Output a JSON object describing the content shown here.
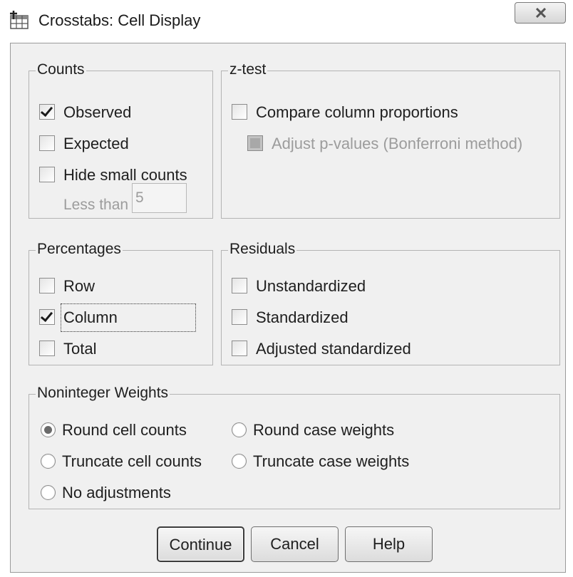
{
  "window": {
    "title": "Crosstabs: Cell Display"
  },
  "counts": {
    "legend": "Counts",
    "observed": {
      "label": "Observed",
      "checked": true
    },
    "expected": {
      "label": "Expected",
      "checked": false
    },
    "hide_small": {
      "label": "Hide small counts",
      "checked": false
    },
    "less_than_label": "Less than",
    "less_than_value": "5"
  },
  "ztest": {
    "legend": "z-test",
    "compare": {
      "label": "Compare column proportions",
      "checked": false
    },
    "adjust": {
      "label": "Adjust p-values (Bonferroni method)",
      "checked": false,
      "disabled": true
    }
  },
  "percentages": {
    "legend": "Percentages",
    "row": {
      "label": "Row",
      "checked": false
    },
    "column": {
      "label": "Column",
      "checked": true
    },
    "total": {
      "label": "Total",
      "checked": false
    }
  },
  "residuals": {
    "legend": "Residuals",
    "unstandardized": {
      "label": "Unstandardized",
      "checked": false
    },
    "standardized": {
      "label": "Standardized",
      "checked": false
    },
    "adjusted": {
      "label": "Adjusted standardized",
      "checked": false
    }
  },
  "weights": {
    "legend": "Noninteger Weights",
    "options": [
      {
        "label": "Round cell counts",
        "selected": true
      },
      {
        "label": "Truncate cell counts",
        "selected": false
      },
      {
        "label": "No adjustments",
        "selected": false
      },
      {
        "label": "Round case weights",
        "selected": false
      },
      {
        "label": "Truncate case weights",
        "selected": false
      }
    ]
  },
  "buttons": {
    "continue": "Continue",
    "cancel": "Cancel",
    "help": "Help"
  },
  "icons": {
    "app": "crosstabs-app-icon",
    "close": "close-icon"
  }
}
